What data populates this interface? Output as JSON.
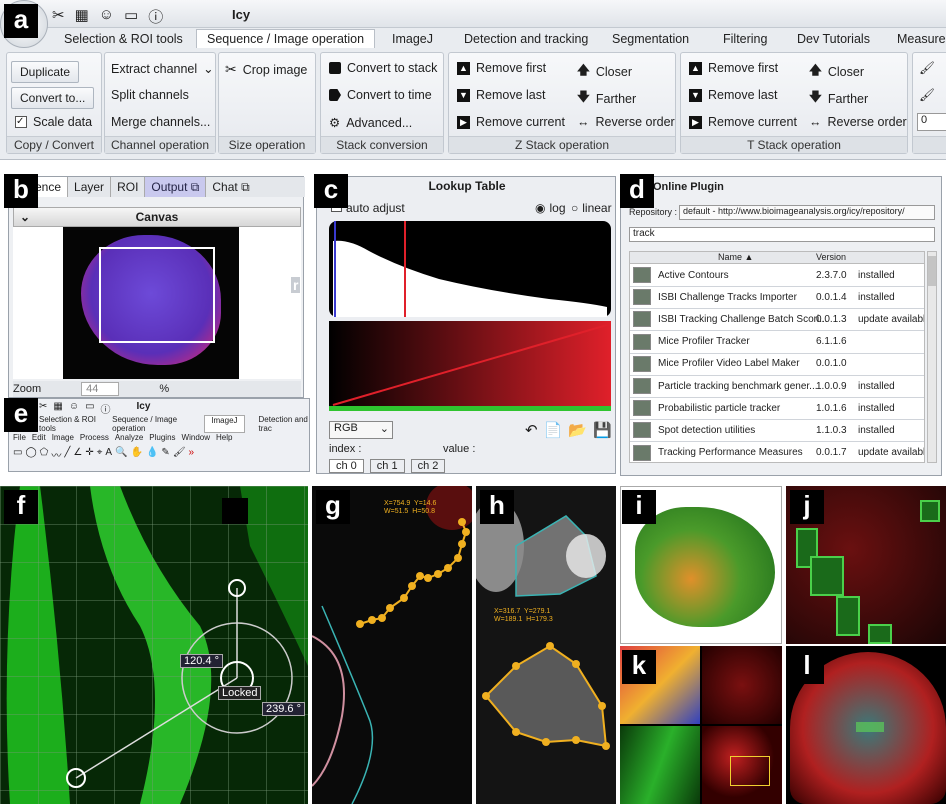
{
  "labels": {
    "a": "a",
    "b": "b",
    "c": "c",
    "d": "d",
    "e": "e",
    "f": "f",
    "g": "g",
    "h": "h",
    "i": "i",
    "j": "j",
    "k": "k",
    "l": "l"
  },
  "app": {
    "title": "Icy"
  },
  "ribbon": {
    "tabs": [
      "Selection & ROI tools",
      "Sequence / Image operation",
      "ImageJ",
      "Detection and tracking",
      "Segmentation",
      "Filtering",
      "Dev Tutorials",
      "Measure"
    ],
    "copy": {
      "duplicate": "Duplicate",
      "convert": "Convert to...",
      "scale": "Scale data",
      "label": "Copy / Convert"
    },
    "channel": {
      "extract": "Extract channel",
      "split": "Split channels",
      "merge": "Merge channels...",
      "label": "Channel operation"
    },
    "size": {
      "crop": "Crop image",
      "label": "Size operation"
    },
    "stack": {
      "to_stack": "Convert to stack",
      "to_time": "Convert to time",
      "advanced": "Advanced...",
      "label": "Stack conversion"
    },
    "zstack": {
      "remove_first": "Remove first",
      "remove_last": "Remove last",
      "remove_current": "Remove current",
      "closer": "Closer",
      "farther": "Farther",
      "reverse": "Reverse order",
      "label": "Z Stack operation"
    },
    "tstack": {
      "remove_first": "Remove first",
      "remove_last": "Remove last",
      "remove_current": "Remove current",
      "closer": "Closer",
      "farther": "Farther",
      "reverse": "Reverse order",
      "label": "T Stack operation"
    },
    "extra": {
      "v": "0"
    }
  },
  "panel_b": {
    "tabs": [
      "ence",
      "Layer",
      "ROI",
      "Output",
      "Chat"
    ],
    "canvas": "Canvas",
    "zoom_label": "Zoom",
    "zoom_value": "44",
    "pct": "%",
    "side_letter": "r"
  },
  "panel_c": {
    "title": "Lookup Table",
    "auto": "auto adjust",
    "log": "log",
    "linear": "linear",
    "mode": "RGB",
    "index": "index :",
    "value": "value :",
    "ch": [
      "ch 0",
      "ch 1",
      "ch 2"
    ]
  },
  "panel_d": {
    "title": "Online Plugin",
    "repo_label": "Repository :",
    "repo_value": "default - http://www.bioimageanalysis.org/icy/repository/",
    "search": "track",
    "cols": {
      "name": "Name",
      "version": "Version"
    },
    "rows": [
      {
        "name": "Active Contours",
        "version": "2.3.7.0",
        "status": "installed"
      },
      {
        "name": "ISBI Challenge Tracks Importer",
        "version": "0.0.1.4",
        "status": "installed"
      },
      {
        "name": "ISBI Tracking Challenge Batch Scori...",
        "version": "0.0.1.3",
        "status": "update available"
      },
      {
        "name": "Mice Profiler Tracker",
        "version": "6.1.1.6",
        "status": ""
      },
      {
        "name": "Mice Profiler Video Label Maker",
        "version": "0.0.1.0",
        "status": ""
      },
      {
        "name": "Particle tracking benchmark gener...",
        "version": "1.0.0.9",
        "status": "installed"
      },
      {
        "name": "Probabilistic particle tracker",
        "version": "1.0.1.6",
        "status": "installed"
      },
      {
        "name": "Spot detection utilities",
        "version": "1.1.0.3",
        "status": "installed"
      },
      {
        "name": "Tracking Performance Measures",
        "version": "0.0.1.7",
        "status": "update available"
      }
    ]
  },
  "panel_e": {
    "title": "Icy",
    "tabs": [
      "Selection & ROI tools",
      "Sequence / Image operation",
      "ImageJ",
      "Detection and trac"
    ],
    "menu": [
      "File",
      "Edit",
      "Image",
      "Process",
      "Analyze",
      "Plugins",
      "Window",
      "Help"
    ]
  },
  "panel_f": {
    "angle1": "120.4 °",
    "angle2": "239.6 °",
    "locked": "Locked"
  },
  "panel_g": {
    "coords": "X=754.9  Y=14.6\nW=51.5  H=50.8"
  },
  "panel_h": {
    "coords": "X=316.7  Y=279.1\nW=189.1  H=179.3"
  },
  "colors": {
    "accent": "#3a6ea5",
    "green": "#2fc42f",
    "red": "#e0202a",
    "orange": "#f0b020"
  }
}
